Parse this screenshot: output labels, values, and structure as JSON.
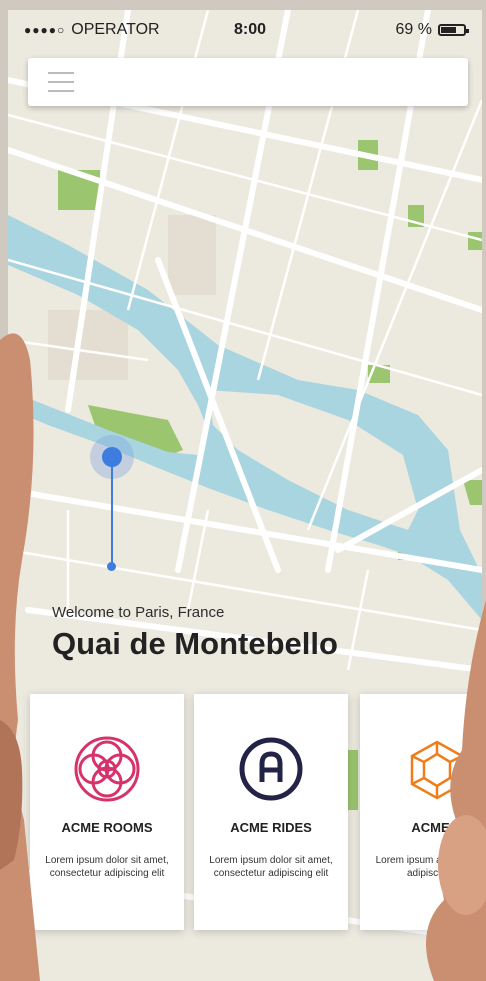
{
  "status_bar": {
    "signal_dots": "●●●●○",
    "carrier": "OPERATOR",
    "time": "8:00",
    "battery_text": "69 %",
    "battery_level": 0.69
  },
  "search": {
    "menu_icon": "hamburger-icon"
  },
  "location": {
    "welcome": "Welcome to Paris, France",
    "place_name": "Quai de Montebello"
  },
  "cards": [
    {
      "name": "ACME ROOMS",
      "description": "Lorem ipsum dolor sit amet, consectetur adipiscing elit",
      "icon": "flower-icon",
      "color": "#d6336c"
    },
    {
      "name": "ACME RIDES",
      "description": "Lorem ipsum dolor sit amet, consectetur adipiscing elit",
      "icon": "letter-a-icon",
      "color": "#232347"
    },
    {
      "name": "ACME C",
      "description": "Lorem ipsum amet, consect adipiscing elit",
      "icon": "cube-icon",
      "color": "#f07d1a"
    }
  ],
  "colors": {
    "map_land": "#ece9df",
    "map_water": "#a9d5e0",
    "map_park": "#9bc56f",
    "map_road": "#ffffff",
    "pin": "#3d7de0"
  }
}
